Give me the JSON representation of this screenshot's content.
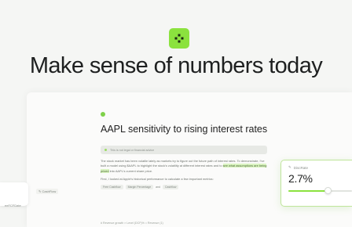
{
  "hero": {
    "headline": "Make sense of numbers today"
  },
  "document": {
    "title": "AAPL sensitivity to rising interest rates",
    "callout": "This is not legal or financial advice",
    "paragraph1_a": "The stock market has been volatile lately as markets try to figure out the future path of interest rates. To demonstrate, I've built a model using $AAPL to highlight the stock's volatility at different interest rates and to ",
    "paragraph1_highlight": "see what assumptions are being priced",
    "paragraph1_b": " into AAPL's current share price.",
    "paragraph2": "First, I looked at Apple's historical performance to calculate a few important metrics:",
    "chips": [
      "Free Cashflow",
      "Margin Percentage",
      "and",
      "Cashflow"
    ],
    "footer": "# Revenue growth  ×  Level (DCF)% =  Revenue (1)"
  },
  "side_panel": {
    "chip": "CashFlow",
    "label": "eeFCFDate"
  },
  "rate_control": {
    "label": "DiscRate",
    "value": "2.7%",
    "slider_fraction": 0.62
  },
  "colors": {
    "accent": "#8be23e",
    "background": "#f5f6f4"
  },
  "icons": {
    "logo": "diamond-grid-logo-icon",
    "rate": "edit-pencil-icon",
    "chip": "edit-pencil-icon"
  }
}
